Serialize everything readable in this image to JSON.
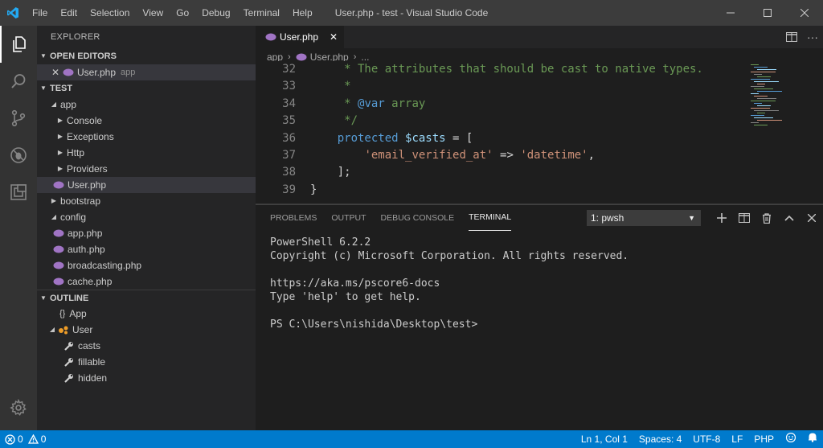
{
  "window": {
    "title": "User.php - test - Visual Studio Code",
    "menu": [
      "File",
      "Edit",
      "Selection",
      "View",
      "Go",
      "Debug",
      "Terminal",
      "Help"
    ]
  },
  "sidebar": {
    "title": "EXPLORER",
    "open_editors_label": "OPEN EDITORS",
    "open_editor": {
      "name": "User.php",
      "folder": "app"
    },
    "project_label": "TEST",
    "tree": [
      {
        "label": "app",
        "kind": "folder-open",
        "depth": 1
      },
      {
        "label": "Console",
        "kind": "folder",
        "depth": 2
      },
      {
        "label": "Exceptions",
        "kind": "folder",
        "depth": 2
      },
      {
        "label": "Http",
        "kind": "folder",
        "depth": 2
      },
      {
        "label": "Providers",
        "kind": "folder",
        "depth": 2
      },
      {
        "label": "User.php",
        "kind": "php",
        "depth": 2,
        "selected": true
      },
      {
        "label": "bootstrap",
        "kind": "folder",
        "depth": 1
      },
      {
        "label": "config",
        "kind": "folder-open",
        "depth": 1
      },
      {
        "label": "app.php",
        "kind": "php",
        "depth": 2
      },
      {
        "label": "auth.php",
        "kind": "php",
        "depth": 2
      },
      {
        "label": "broadcasting.php",
        "kind": "php",
        "depth": 2
      },
      {
        "label": "cache.php",
        "kind": "php",
        "depth": 2
      }
    ],
    "outline_label": "OUTLINE",
    "outline": [
      {
        "label": "App",
        "icon": "namespace-icon"
      },
      {
        "label": "User",
        "icon": "class-icon"
      },
      {
        "label": "casts",
        "icon": "property-icon"
      },
      {
        "label": "fillable",
        "icon": "property-icon"
      },
      {
        "label": "hidden",
        "icon": "property-icon"
      }
    ]
  },
  "editor": {
    "tab_label": "User.php",
    "breadcrumb": [
      "app",
      "User.php",
      "..."
    ],
    "lines": [
      {
        "n": "32",
        "parts": [
          [
            "c-comment",
            "     * The attributes that should be cast to native types."
          ]
        ]
      },
      {
        "n": "33",
        "parts": [
          [
            "c-comment",
            "     *"
          ]
        ]
      },
      {
        "n": "34",
        "parts": [
          [
            "c-comment",
            "     * "
          ],
          [
            "c-kw",
            "@var"
          ],
          [
            "c-comment",
            " array"
          ]
        ]
      },
      {
        "n": "35",
        "parts": [
          [
            "c-comment",
            "     */"
          ]
        ]
      },
      {
        "n": "36",
        "parts": [
          [
            "c-plain",
            "    "
          ],
          [
            "c-kw",
            "protected"
          ],
          [
            "c-plain",
            " "
          ],
          [
            "c-var",
            "$casts"
          ],
          [
            "c-plain",
            " = ["
          ]
        ]
      },
      {
        "n": "37",
        "parts": [
          [
            "c-plain",
            "        "
          ],
          [
            "c-str",
            "'email_verified_at'"
          ],
          [
            "c-plain",
            " => "
          ],
          [
            "c-str",
            "'datetime'"
          ],
          [
            "c-plain",
            ","
          ]
        ]
      },
      {
        "n": "38",
        "parts": [
          [
            "c-plain",
            "    ];"
          ]
        ]
      },
      {
        "n": "39",
        "parts": [
          [
            "c-plain",
            "}"
          ]
        ]
      }
    ]
  },
  "panel": {
    "tabs": [
      "PROBLEMS",
      "OUTPUT",
      "DEBUG CONSOLE",
      "TERMINAL"
    ],
    "active_tab": "TERMINAL",
    "terminal_select": "1: pwsh",
    "terminal_lines": [
      "PowerShell 6.2.2",
      "Copyright (c) Microsoft Corporation. All rights reserved.",
      "",
      "https://aka.ms/pscore6-docs",
      "Type 'help' to get help.",
      "",
      "PS C:\\Users\\nishida\\Desktop\\test>"
    ]
  },
  "statusbar": {
    "errors": "0",
    "warnings": "0",
    "position": "Ln 1, Col 1",
    "spaces": "Spaces: 4",
    "encoding": "UTF-8",
    "eol": "LF",
    "language": "PHP"
  },
  "colors": {
    "statusbar": "#007acc",
    "comment": "#6a9955",
    "keyword": "#569cd6",
    "variable": "#9cdcfe",
    "string": "#ce9178",
    "php_icon": "#a074c4"
  }
}
